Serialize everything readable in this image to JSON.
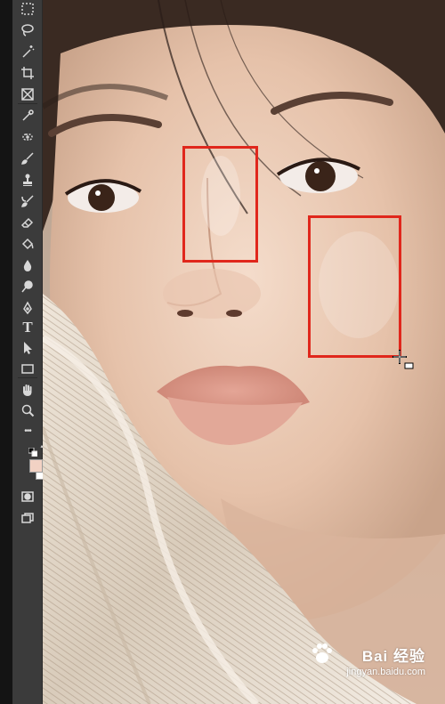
{
  "toolbar": {
    "tools": [
      {
        "name": "rectangular-marquee-tool",
        "icon": "marquee-icon"
      },
      {
        "name": "lasso-tool",
        "icon": "lasso-icon"
      },
      {
        "name": "magic-wand-tool",
        "icon": "magic-wand-icon"
      },
      {
        "name": "crop-tool",
        "icon": "crop-icon"
      },
      {
        "name": "frame-tool",
        "icon": "frame-icon"
      },
      {
        "name": "eyedropper-tool",
        "icon": "eyedropper-icon"
      },
      {
        "name": "spot-healing-tool",
        "icon": "healing-icon"
      },
      {
        "name": "brush-tool",
        "icon": "brush-icon"
      },
      {
        "name": "clone-stamp-tool",
        "icon": "stamp-icon"
      },
      {
        "name": "history-brush-tool",
        "icon": "history-brush-icon"
      },
      {
        "name": "eraser-tool",
        "icon": "eraser-icon"
      },
      {
        "name": "paint-bucket-tool",
        "icon": "paint-bucket-icon"
      },
      {
        "name": "blur-tool",
        "icon": "blur-drop-icon"
      },
      {
        "name": "dodge-tool",
        "icon": "dodge-icon"
      },
      {
        "name": "pen-tool",
        "icon": "pen-icon"
      },
      {
        "name": "type-tool",
        "icon": "type-icon",
        "label": "T"
      },
      {
        "name": "path-selection-tool",
        "icon": "arrow-icon"
      },
      {
        "name": "rectangle-tool",
        "icon": "rectangle-icon"
      },
      {
        "name": "hand-tool",
        "icon": "hand-icon"
      },
      {
        "name": "zoom-tool",
        "icon": "zoom-icon"
      },
      {
        "name": "edit-toolbar",
        "icon": "more-icon",
        "label": "•••"
      }
    ],
    "colors": {
      "foreground": "#f2d2c4",
      "background": "#ffffff"
    }
  },
  "canvas": {
    "accent_selection_color": "#e0271c",
    "cursor_icon": "crosshair-add-icon"
  },
  "watermark": {
    "title": "Bai 经验",
    "url": "jingyan.baidu.com"
  }
}
